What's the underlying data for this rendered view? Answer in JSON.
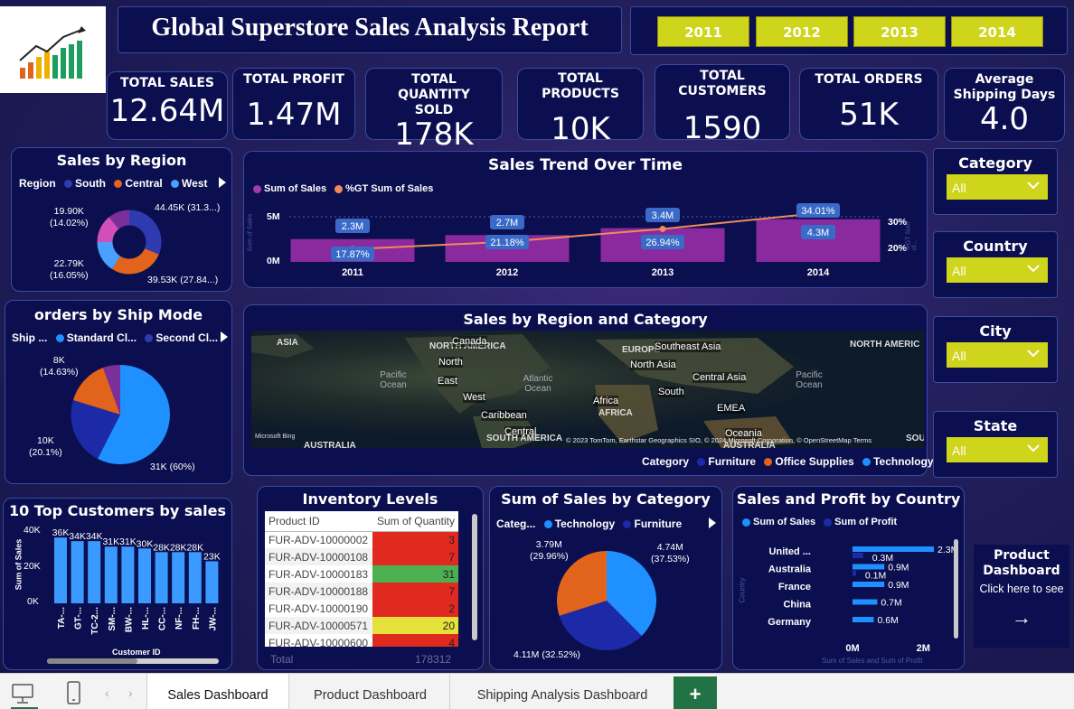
{
  "header": {
    "title": "Global Superstore Sales Analysis Report"
  },
  "years": [
    "2011",
    "2012",
    "2013",
    "2014"
  ],
  "kpis": [
    {
      "label": "TOTAL SALES",
      "value": "12.64M"
    },
    {
      "label": "TOTAL PROFIT",
      "value": "1.47M"
    },
    {
      "label": "TOTAL QUANTITY SOLD",
      "value": "178K"
    },
    {
      "label": "TOTAL PRODUCTS",
      "value": "10K"
    },
    {
      "label": "TOTAL CUSTOMERS",
      "value": "1590"
    },
    {
      "label": "TOTAL ORDERS",
      "value": "51K"
    },
    {
      "label": "Average Shipping Days",
      "value": "4.0"
    }
  ],
  "slicers": [
    {
      "label": "Category",
      "value": "All"
    },
    {
      "label": "Country",
      "value": "All"
    },
    {
      "label": "City",
      "value": "All"
    },
    {
      "label": "State",
      "value": "All"
    }
  ],
  "region": {
    "title": "Sales by Region",
    "legend_title": "Region",
    "legend": [
      "South",
      "Central",
      "West"
    ],
    "labels": {
      "top_left": "19.90K",
      "top_left_pct": "(14.02%)",
      "bottom_left": "22.79K",
      "bottom_left_pct": "(16.05%)",
      "top_right": "44.45K (31.3...)",
      "bottom_right": "39.53K (27.84...)"
    },
    "colors": [
      "#2e3bb0",
      "#e2631c",
      "#4aa0ff",
      "#d24fb7",
      "#7a2f9a"
    ]
  },
  "shipmode": {
    "title": "orders by Ship Mode",
    "legend_title": "Ship ...",
    "legend": [
      "Standard Cl...",
      "Second Cl..."
    ],
    "labels": {
      "a": "8K",
      "a_pct": "(14.63%)",
      "b": "10K",
      "b_pct": "(20.1%)",
      "c": "31K (60%)"
    }
  },
  "trend": {
    "title": "Sales Trend Over Time",
    "legend": [
      "Sum of Sales",
      "%GT Sum of Sales"
    ],
    "y_left_ticks": [
      "5M",
      "0M"
    ],
    "y_right_ticks": [
      "30%",
      "20%"
    ],
    "y_left_label": "Sum of Sales",
    "y_right_label": "%GT Sum of...",
    "chart_data": {
      "type": "bar",
      "categories": [
        "2011",
        "2012",
        "2013",
        "2014"
      ],
      "series": [
        {
          "name": "Sum of Sales",
          "values": [
            2.3,
            2.7,
            3.4,
            4.3
          ],
          "labels": [
            "2.3M",
            "2.7M",
            "3.4M",
            "4.3M"
          ]
        },
        {
          "name": "%GT Sum of Sales",
          "values": [
            17.87,
            21.18,
            26.94,
            34.01
          ],
          "labels": [
            "17.87%",
            "21.18%",
            "26.94%",
            "34.01%"
          ]
        }
      ]
    }
  },
  "map": {
    "title": "Sales by Region and Category",
    "labels": [
      "ASIA",
      "NORTH AMERICA",
      "Canada",
      "North",
      "East",
      "West",
      "Caribbean",
      "Central",
      "SOUTH AMERICA",
      "Pacific Ocean",
      "Atlantic Ocean",
      "EUROPE",
      "Southeast Asia",
      "North Asia",
      "Central Asia",
      "South",
      "Africa",
      "AFRICA",
      "EMEA",
      "Oceania",
      "AUSTRALIA",
      "Pacific Ocean",
      "NORTH AMERIC",
      "AUSTRALIA",
      "SOU"
    ],
    "attribution": "© 2023 TomTom, Earthstar Geographics SIO, © 2024 Microsoft Corporation, © OpenStreetMap  Terms",
    "bing": "Microsoft Bing",
    "legend_title": "Category",
    "legend": [
      "Furniture",
      "Office Supplies",
      "Technology"
    ]
  },
  "top_customers": {
    "title": "10 Top Customers by sales",
    "y_label": "Sum of Sales",
    "x_label": "Customer ID",
    "y_ticks": [
      "40K",
      "20K",
      "0K"
    ],
    "chart_data": {
      "type": "bar",
      "categories": [
        "TA-...",
        "GT-...",
        "TC-2...",
        "SM-...",
        "BW-...",
        "HL-...",
        "CC-...",
        "NF-...",
        "FH-...",
        "JW-..."
      ],
      "values": [
        36,
        34,
        34,
        31,
        31,
        30,
        28,
        28,
        28,
        23
      ],
      "labels": [
        "36K",
        "34K",
        "34K",
        "31K",
        "31K",
        "30K",
        "28K",
        "28K",
        "28K",
        "23K"
      ],
      "ylim": [
        0,
        40
      ]
    }
  },
  "inventory": {
    "title": "Inventory Levels",
    "headers": [
      "Product ID",
      "Sum of Quantity"
    ],
    "rows": [
      {
        "id": "FUR-ADV-10000002",
        "qty": "3",
        "color": "#e02a1f"
      },
      {
        "id": "FUR-ADV-10000108",
        "qty": "7",
        "color": "#e02a1f"
      },
      {
        "id": "FUR-ADV-10000183",
        "qty": "31",
        "color": "#4caf50"
      },
      {
        "id": "FUR-ADV-10000188",
        "qty": "7",
        "color": "#e02a1f"
      },
      {
        "id": "FUR-ADV-10000190",
        "qty": "2",
        "color": "#e02a1f"
      },
      {
        "id": "FUR-ADV-10000571",
        "qty": "20",
        "color": "#e6e03a"
      },
      {
        "id": "FUR-ADV-10000600",
        "qty": "4",
        "color": "#e02a1f"
      }
    ],
    "total_label": "Total",
    "total_value": "178312"
  },
  "category": {
    "title": "Sum of Sales by Category",
    "legend_title": "Categ...",
    "legend": [
      "Technology",
      "Furniture"
    ],
    "chart_data": {
      "type": "pie",
      "categories": [
        "Technology",
        "Furniture",
        "Office Supplies"
      ],
      "values": [
        37.53,
        32.52,
        29.96
      ]
    },
    "labels": {
      "tech": "4.74M",
      "tech_pct": "(37.53%)",
      "furn": "4.11M (32.52%)",
      "off": "3.79M",
      "off_pct": "(29.96%)"
    }
  },
  "country": {
    "title": "Sales and Profit by Country",
    "legend": [
      "Sum of Sales",
      "Sum of Profit"
    ],
    "x_ticks": [
      "0M",
      "2M"
    ],
    "x_label": "Sum of Sales and Sum of Profit",
    "y_label": "Country",
    "chart_data": {
      "type": "bar",
      "categories": [
        "United ...",
        "Australia",
        "France",
        "China",
        "Germany"
      ],
      "series": [
        {
          "name": "Sum of Sales",
          "values": [
            2.3,
            0.9,
            0.9,
            0.7,
            0.6
          ],
          "labels": [
            "2.3M",
            "0.9M",
            "0.9M",
            "0.7M",
            "0.6M"
          ]
        },
        {
          "name": "Sum of Profit",
          "values": [
            0.3,
            0.1
          ],
          "labels": [
            "0.3M",
            "0.1M"
          ]
        }
      ],
      "xlim": [
        0,
        2.5
      ]
    }
  },
  "nav_card": {
    "title": "Product Dashboard",
    "subtitle": "Click here to see",
    "arrow": "→"
  },
  "tabs": [
    "Sales Dashboard",
    "Product Dashboard",
    "Shipping Analysis Dashboard"
  ],
  "add_tab": "+"
}
